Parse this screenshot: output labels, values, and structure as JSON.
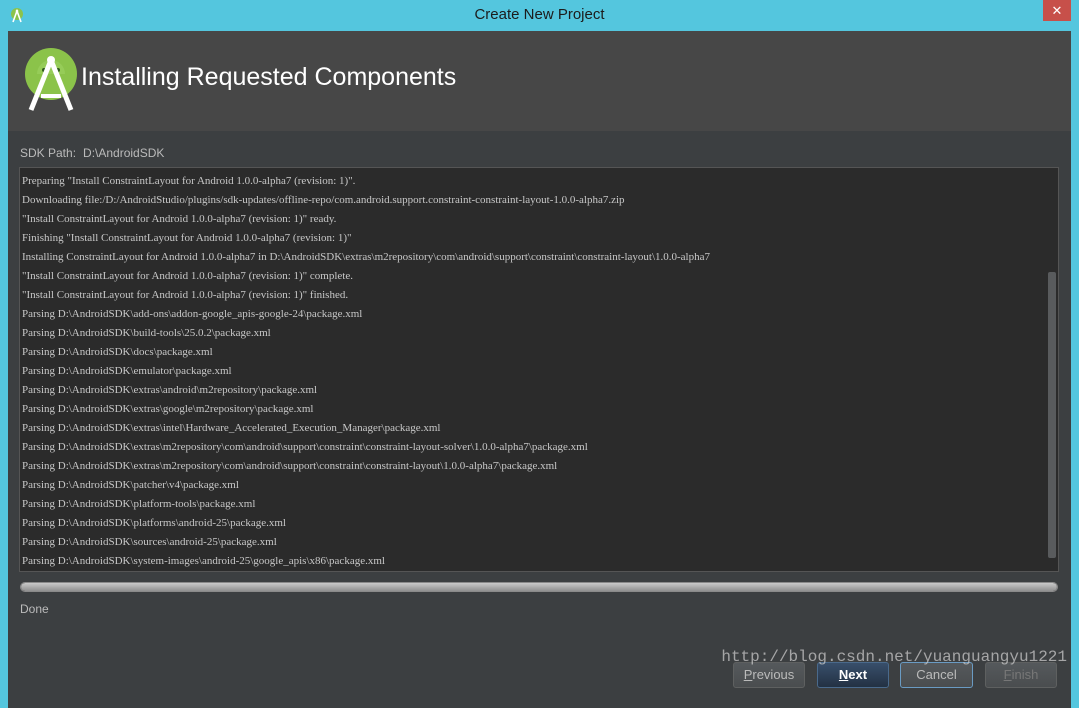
{
  "window": {
    "title": "Create New Project",
    "close_glyph": "✕"
  },
  "header": {
    "title": "Installing Requested Components",
    "logo_icon": "android-studio-logo"
  },
  "sdk_path": {
    "label": "SDK Path:",
    "value": "D:\\AndroidSDK"
  },
  "log": {
    "lines": [
      "Preparing \"Install ConstraintLayout for Android 1.0.0-alpha7 (revision: 1)\".",
      "Downloading file:/D:/AndroidStudio/plugins/sdk-updates/offline-repo/com.android.support.constraint-constraint-layout-1.0.0-alpha7.zip",
      "\"Install ConstraintLayout for Android 1.0.0-alpha7 (revision: 1)\" ready.",
      "Finishing \"Install ConstraintLayout for Android 1.0.0-alpha7 (revision: 1)\"",
      "Installing ConstraintLayout for Android 1.0.0-alpha7 in D:\\AndroidSDK\\extras\\m2repository\\com\\android\\support\\constraint\\constraint-layout\\1.0.0-alpha7",
      "\"Install ConstraintLayout for Android 1.0.0-alpha7 (revision: 1)\" complete.",
      "\"Install ConstraintLayout for Android 1.0.0-alpha7 (revision: 1)\" finished.",
      "Parsing D:\\AndroidSDK\\add-ons\\addon-google_apis-google-24\\package.xml",
      "Parsing D:\\AndroidSDK\\build-tools\\25.0.2\\package.xml",
      "Parsing D:\\AndroidSDK\\docs\\package.xml",
      "Parsing D:\\AndroidSDK\\emulator\\package.xml",
      "Parsing D:\\AndroidSDK\\extras\\android\\m2repository\\package.xml",
      "Parsing D:\\AndroidSDK\\extras\\google\\m2repository\\package.xml",
      "Parsing D:\\AndroidSDK\\extras\\intel\\Hardware_Accelerated_Execution_Manager\\package.xml",
      "Parsing D:\\AndroidSDK\\extras\\m2repository\\com\\android\\support\\constraint\\constraint-layout-solver\\1.0.0-alpha7\\package.xml",
      "Parsing D:\\AndroidSDK\\extras\\m2repository\\com\\android\\support\\constraint\\constraint-layout\\1.0.0-alpha7\\package.xml",
      "Parsing D:\\AndroidSDK\\patcher\\v4\\package.xml",
      "Parsing D:\\AndroidSDK\\platform-tools\\package.xml",
      "Parsing D:\\AndroidSDK\\platforms\\android-25\\package.xml",
      "Parsing D:\\AndroidSDK\\sources\\android-25\\package.xml",
      "Parsing D:\\AndroidSDK\\system-images\\android-25\\google_apis\\x86\\package.xml"
    ]
  },
  "progress": {
    "percent": 100
  },
  "status": {
    "text": "Done"
  },
  "buttons": {
    "previous": "Previous",
    "next": "Next",
    "cancel": "Cancel",
    "finish": "Finish"
  },
  "watermark": "http://blog.csdn.net/yuanguangyu1221",
  "colors": {
    "titlebar": "#54c6de",
    "background": "#3c3f41",
    "header": "#474747",
    "log_background": "#2b2b2b",
    "android_green": "#8bc34a",
    "close_button": "#c7504a"
  }
}
